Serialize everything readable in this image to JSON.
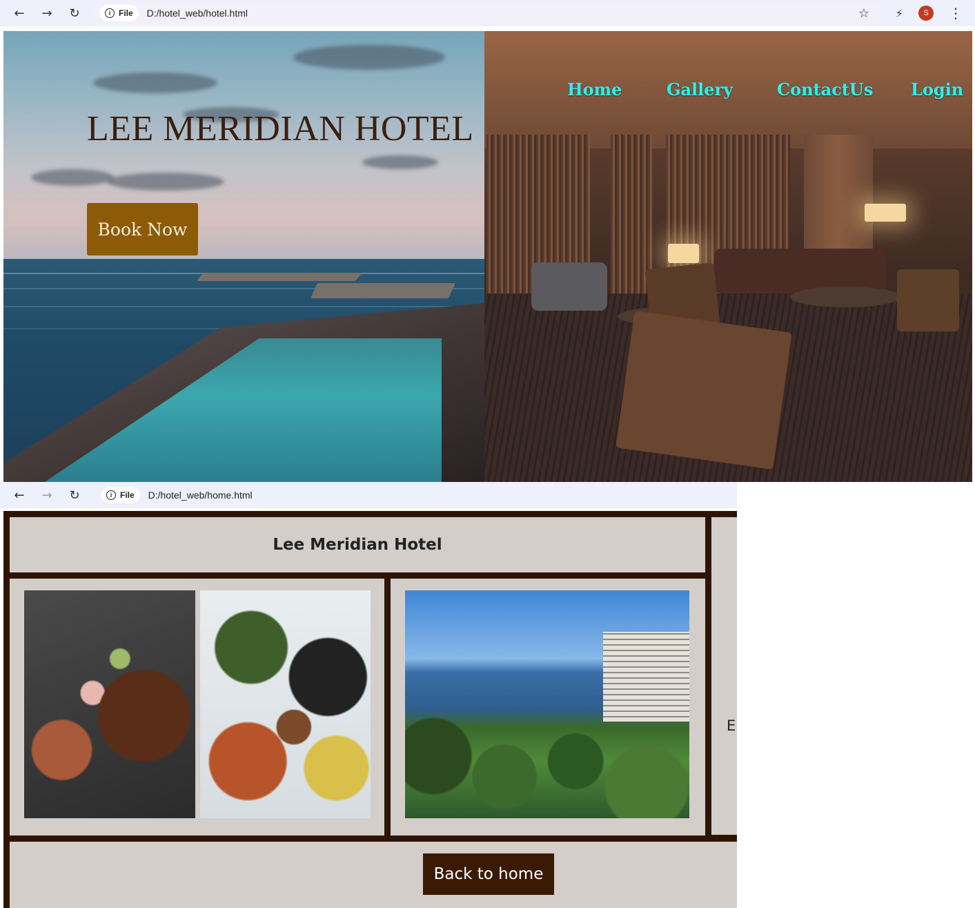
{
  "browser_top": {
    "chip_label": "File",
    "url": "D:/hotel_web/hotel.html",
    "avatar_letter": "S"
  },
  "browser_bottom": {
    "chip_label": "File",
    "url": "D:/hotel_web/home.html"
  },
  "hero": {
    "title": "LEE MERIDIAN HOTEL",
    "book_button": "Book Now",
    "nav": [
      {
        "label": "Home"
      },
      {
        "label": "Gallery"
      },
      {
        "label": "ContactUs"
      },
      {
        "label": "Login"
      }
    ]
  },
  "home_page": {
    "title": "Lee Meridian Hotel",
    "side_text": "En",
    "back_button": "Back to home"
  },
  "colors": {
    "nav_link": "#2bf0f0",
    "book_button_bg": "#8d5b07",
    "frame": "#2e1503",
    "panel_bg": "#d3ceca",
    "back_button_bg": "#3a1a05"
  }
}
